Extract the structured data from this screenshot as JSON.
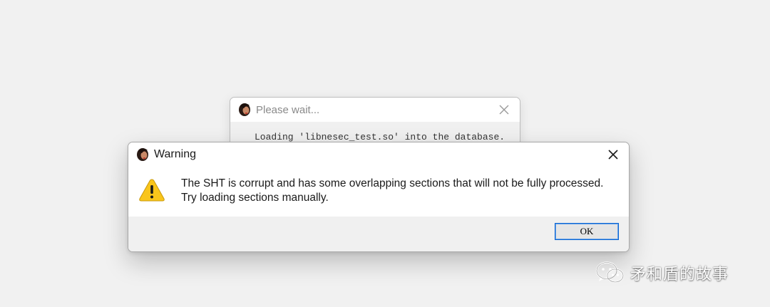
{
  "background_dialog": {
    "title": "Please wait...",
    "message": "Loading 'libnesec_test.so' into the database.",
    "icon": "app-avatar-icon"
  },
  "warning_dialog": {
    "title": "Warning",
    "message_line1": "The SHT is corrupt and has some overlapping sections that will not be fully processed.",
    "message_line2": "Try loading sections manually.",
    "ok_label": "OK",
    "icon": "warning-triangle-icon",
    "close_icon": "close-icon"
  },
  "watermark": {
    "text": "矛和盾的故事",
    "icon": "wechat-icon"
  },
  "colors": {
    "desktop_bg": "#f1f1f1",
    "warning_yellow": "#f9c51b",
    "button_border": "#0a64d2"
  }
}
